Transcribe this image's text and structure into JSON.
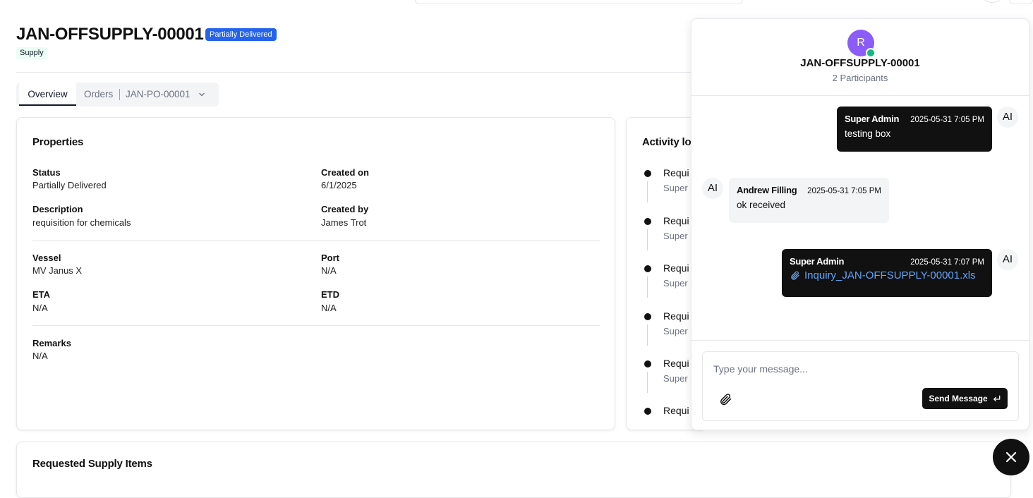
{
  "header": {
    "title": "JAN-OFFSUPPLY-00001",
    "status_badge": "Partially Delivered",
    "category": "Supply"
  },
  "tabs": {
    "overview": "Overview",
    "orders": "Orders",
    "order_id": "JAN-PO-00001"
  },
  "properties": {
    "title": "Properties",
    "status_label": "Status",
    "status_value": "Partially Delivered",
    "created_on_label": "Created on",
    "created_on_value": "6/1/2025",
    "description_label": "Description",
    "description_value": "requisition for chemicals",
    "created_by_label": "Created by",
    "created_by_value": "James Trot",
    "vessel_label": "Vessel",
    "vessel_value": "MV Janus X",
    "port_label": "Port",
    "port_value": "N/A",
    "eta_label": "ETA",
    "eta_value": "N/A",
    "etd_label": "ETD",
    "etd_value": "N/A",
    "remarks_label": "Remarks",
    "remarks_value": "N/A"
  },
  "activity": {
    "title": "Activity log",
    "items": [
      {
        "title": "Requi",
        "sub": "Super"
      },
      {
        "title": "Requi",
        "sub": "Super"
      },
      {
        "title": "Requi",
        "sub": "Super"
      },
      {
        "title": "Requi",
        "sub": "Super"
      },
      {
        "title": "Requi",
        "sub": "Super"
      },
      {
        "title": "Requi",
        "sub": ""
      }
    ]
  },
  "supply_items": {
    "title": "Requested Supply Items"
  },
  "chat": {
    "avatar_initial": "R",
    "title": "JAN-OFFSUPPLY-00001",
    "participants": "2 Participants",
    "messages": [
      {
        "sender": "Super Admin",
        "time": "2025-05-31 7:05 PM",
        "text": "testing box",
        "avatar": "AI"
      },
      {
        "sender": "Andrew Filling",
        "time": "2025-05-31 7:05 PM",
        "text": "ok received",
        "avatar": "AI"
      },
      {
        "sender": "Super Admin",
        "time": "2025-05-31 7:07 PM",
        "file": "Inquiry_JAN-OFFSUPPLY-00001.xls",
        "avatar": "AI"
      }
    ],
    "input_placeholder": "Type your message...",
    "send_label": "Send Message"
  },
  "colors": {
    "badge_blue": "#2563eb",
    "chat_avatar": "#8b5cf6",
    "online": "#10b981",
    "dark": "#111111",
    "link": "#60a5fa"
  }
}
